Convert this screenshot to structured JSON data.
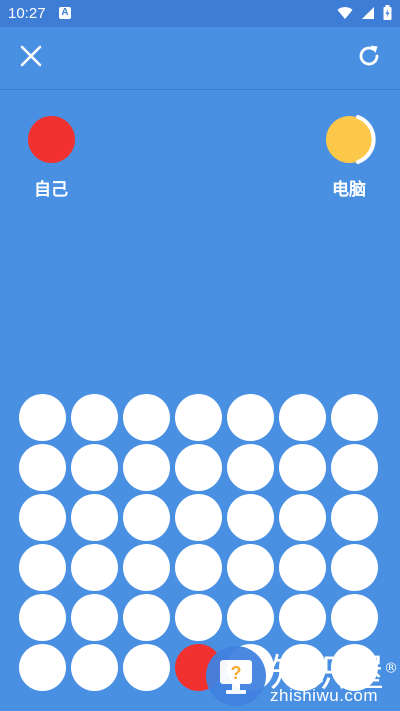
{
  "status_bar": {
    "time": "10:27",
    "badge": "A",
    "icons": [
      "wifi-icon",
      "signal-icon",
      "battery-icon"
    ]
  },
  "toolbar": {
    "close_icon": "close-icon",
    "restart_icon": "restart-icon"
  },
  "players": {
    "self": {
      "name": "自己",
      "color": "#f0312f"
    },
    "cpu": {
      "name": "电脑",
      "color": "#fbc84a",
      "turn_ring": true
    }
  },
  "board": {
    "rows": 6,
    "cols": 7,
    "empty_color": "#ffffff",
    "cells": [
      [
        0,
        0,
        0,
        0,
        0,
        0,
        0
      ],
      [
        0,
        0,
        0,
        0,
        0,
        0,
        0
      ],
      [
        0,
        0,
        0,
        0,
        0,
        0,
        0
      ],
      [
        0,
        0,
        0,
        0,
        0,
        0,
        0
      ],
      [
        0,
        0,
        0,
        0,
        0,
        0,
        0
      ],
      [
        0,
        0,
        0,
        1,
        0,
        0,
        0
      ]
    ]
  },
  "colors": {
    "background": "#4a90e2",
    "status_bar": "#3d7dd6"
  },
  "watermark": {
    "title": "知识屋",
    "registered": "®",
    "subtitle": "zhishiwu.com",
    "icon": "monitor-question-icon"
  }
}
